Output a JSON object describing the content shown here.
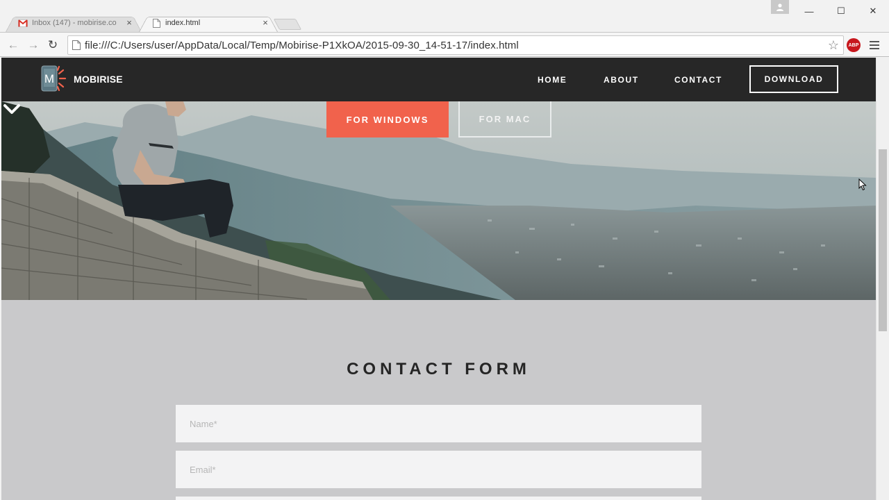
{
  "browser": {
    "tabs": [
      {
        "title": "Inbox (147) - mobirise.co",
        "icon": "gmail-icon",
        "active": false,
        "close": "×"
      },
      {
        "title": "index.html",
        "icon": "page-icon",
        "active": true,
        "close": "×"
      }
    ],
    "url": "file:///C:/Users/user/AppData/Local/Temp/Mobirise-P1XkOA/2015-09-30_14-51-17/index.html",
    "extension_badge": "ABP",
    "window_controls": {
      "minimize": "—",
      "maximize": "☐",
      "close": "✕"
    },
    "nav": {
      "back": "←",
      "forward": "→",
      "reload": "↻",
      "star": "☆"
    }
  },
  "site": {
    "brand": "MOBIRISE",
    "logo_letter": "M",
    "menu": [
      {
        "label": "HOME"
      },
      {
        "label": "ABOUT"
      },
      {
        "label": "CONTACT"
      }
    ],
    "download_label": "DOWNLOAD",
    "hero": {
      "primary_button": "FOR WINDOWS",
      "secondary_button": "FOR MAC"
    },
    "contact": {
      "title": "CONTACT FORM",
      "name_placeholder": "Name*",
      "email_placeholder": "Email*"
    }
  },
  "colors": {
    "accent": "#f1624c",
    "nav_bg": "#272727",
    "section_bg": "#c9c9cb"
  }
}
